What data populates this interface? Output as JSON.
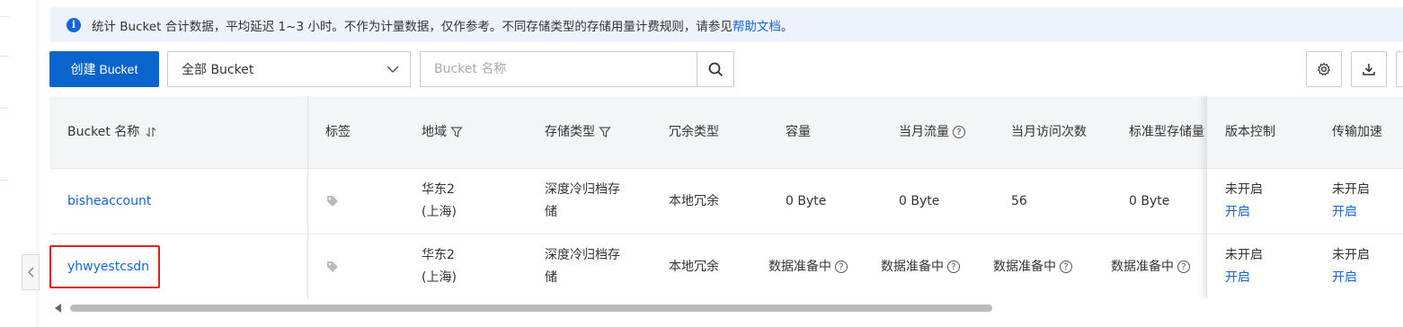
{
  "notice": {
    "text": "统计 Bucket 合计数据，平均延迟 1~3 小时。不作为计量数据，仅作参考。不同存储类型的存储用量计费规则，请参见",
    "link": "帮助文档",
    "suffix": "。"
  },
  "toolbar": {
    "create_label": "创建 Bucket",
    "filter_value": "全部 Bucket",
    "search_placeholder": "Bucket 名称"
  },
  "columns": {
    "name": "Bucket 名称",
    "tags": "标签",
    "region": "地域",
    "storage_class": "存储类型",
    "redundancy": "冗余类型",
    "capacity": "容量",
    "traffic": "当月流量",
    "visits": "当月访问次数",
    "std_storage": "标准型存储量",
    "versioning": "版本控制",
    "acceleration": "传输加速"
  },
  "rows": [
    {
      "name": "bisheaccount",
      "region_1": "华东2",
      "region_2": "(上海)",
      "storage_1": "深度冷归档存",
      "storage_2": "储",
      "redundancy": "本地冗余",
      "capacity": "0 Byte",
      "traffic": "0 Byte",
      "visits": "56",
      "std_storage": "0 Byte",
      "versioning_status": "未开启",
      "versioning_action": "开启",
      "accel_status": "未开启",
      "accel_action": "开启"
    },
    {
      "name": "yhwyestcsdn",
      "region_1": "华东2",
      "region_2": "(上海)",
      "storage_1": "深度冷归档存",
      "storage_2": "储",
      "redundancy": "本地冗余",
      "capacity": "数据准备中",
      "traffic": "数据准备中",
      "visits": "数据准备中",
      "std_storage": "数据准备中",
      "versioning_status": "未开启",
      "versioning_action": "开启",
      "accel_status": "未开启",
      "accel_action": "开启"
    }
  ],
  "colors": {
    "primary": "#0a64cc",
    "link": "#1565d8",
    "highlight": "#e02020"
  }
}
